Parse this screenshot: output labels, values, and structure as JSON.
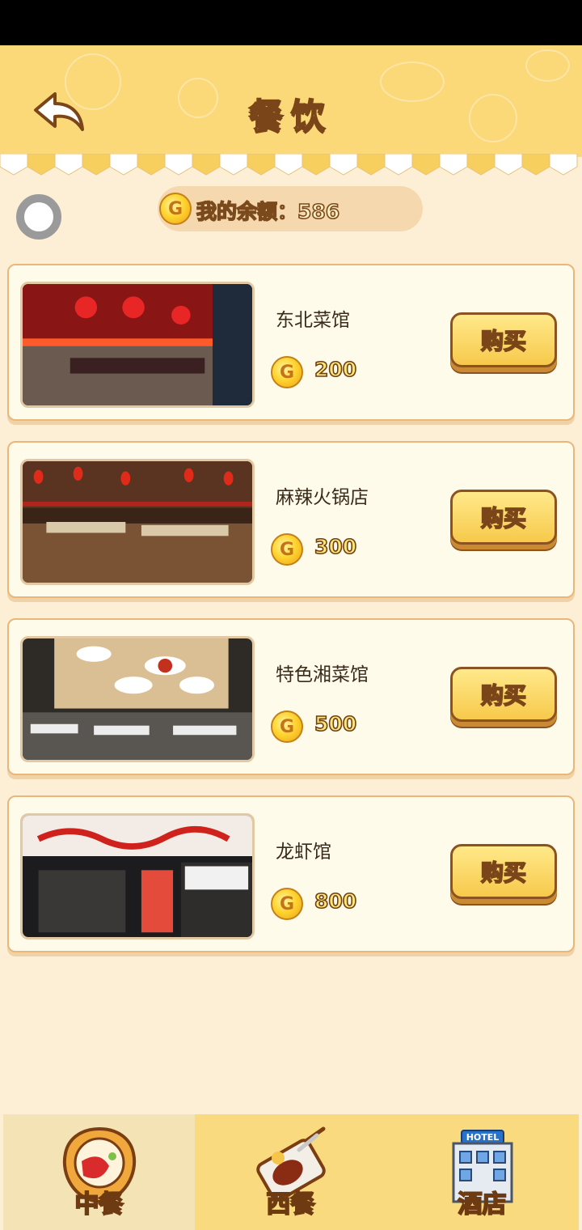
{
  "header": {
    "title": "餐饮",
    "back_icon": "back-arrow-icon",
    "color": "#fbd878"
  },
  "balance": {
    "coin_letter": "G",
    "text": "我的余额：586"
  },
  "restaurants": [
    {
      "name": "东北菜馆",
      "price": "200",
      "coin_letter": "G",
      "buy_label": "购买",
      "image": "northeast-restaurant-photo"
    },
    {
      "name": "麻辣火锅店",
      "price": "300",
      "coin_letter": "G",
      "buy_label": "购买",
      "image": "hotpot-restaurant-photo"
    },
    {
      "name": "特色湘菜馆",
      "price": "500",
      "coin_letter": "G",
      "buy_label": "购买",
      "image": "hunan-restaurant-photo"
    },
    {
      "name": "龙虾馆",
      "price": "800",
      "coin_letter": "G",
      "buy_label": "购买",
      "image": "crayfish-restaurant-photo"
    }
  ],
  "bottom_nav": {
    "tabs": [
      {
        "label": "中餐",
        "icon": "chinese-food-icon",
        "active": true
      },
      {
        "label": "西餐",
        "icon": "western-food-icon",
        "active": false
      },
      {
        "label": "酒店",
        "icon": "hotel-icon",
        "active": false,
        "sign": "HOTEL"
      }
    ]
  }
}
